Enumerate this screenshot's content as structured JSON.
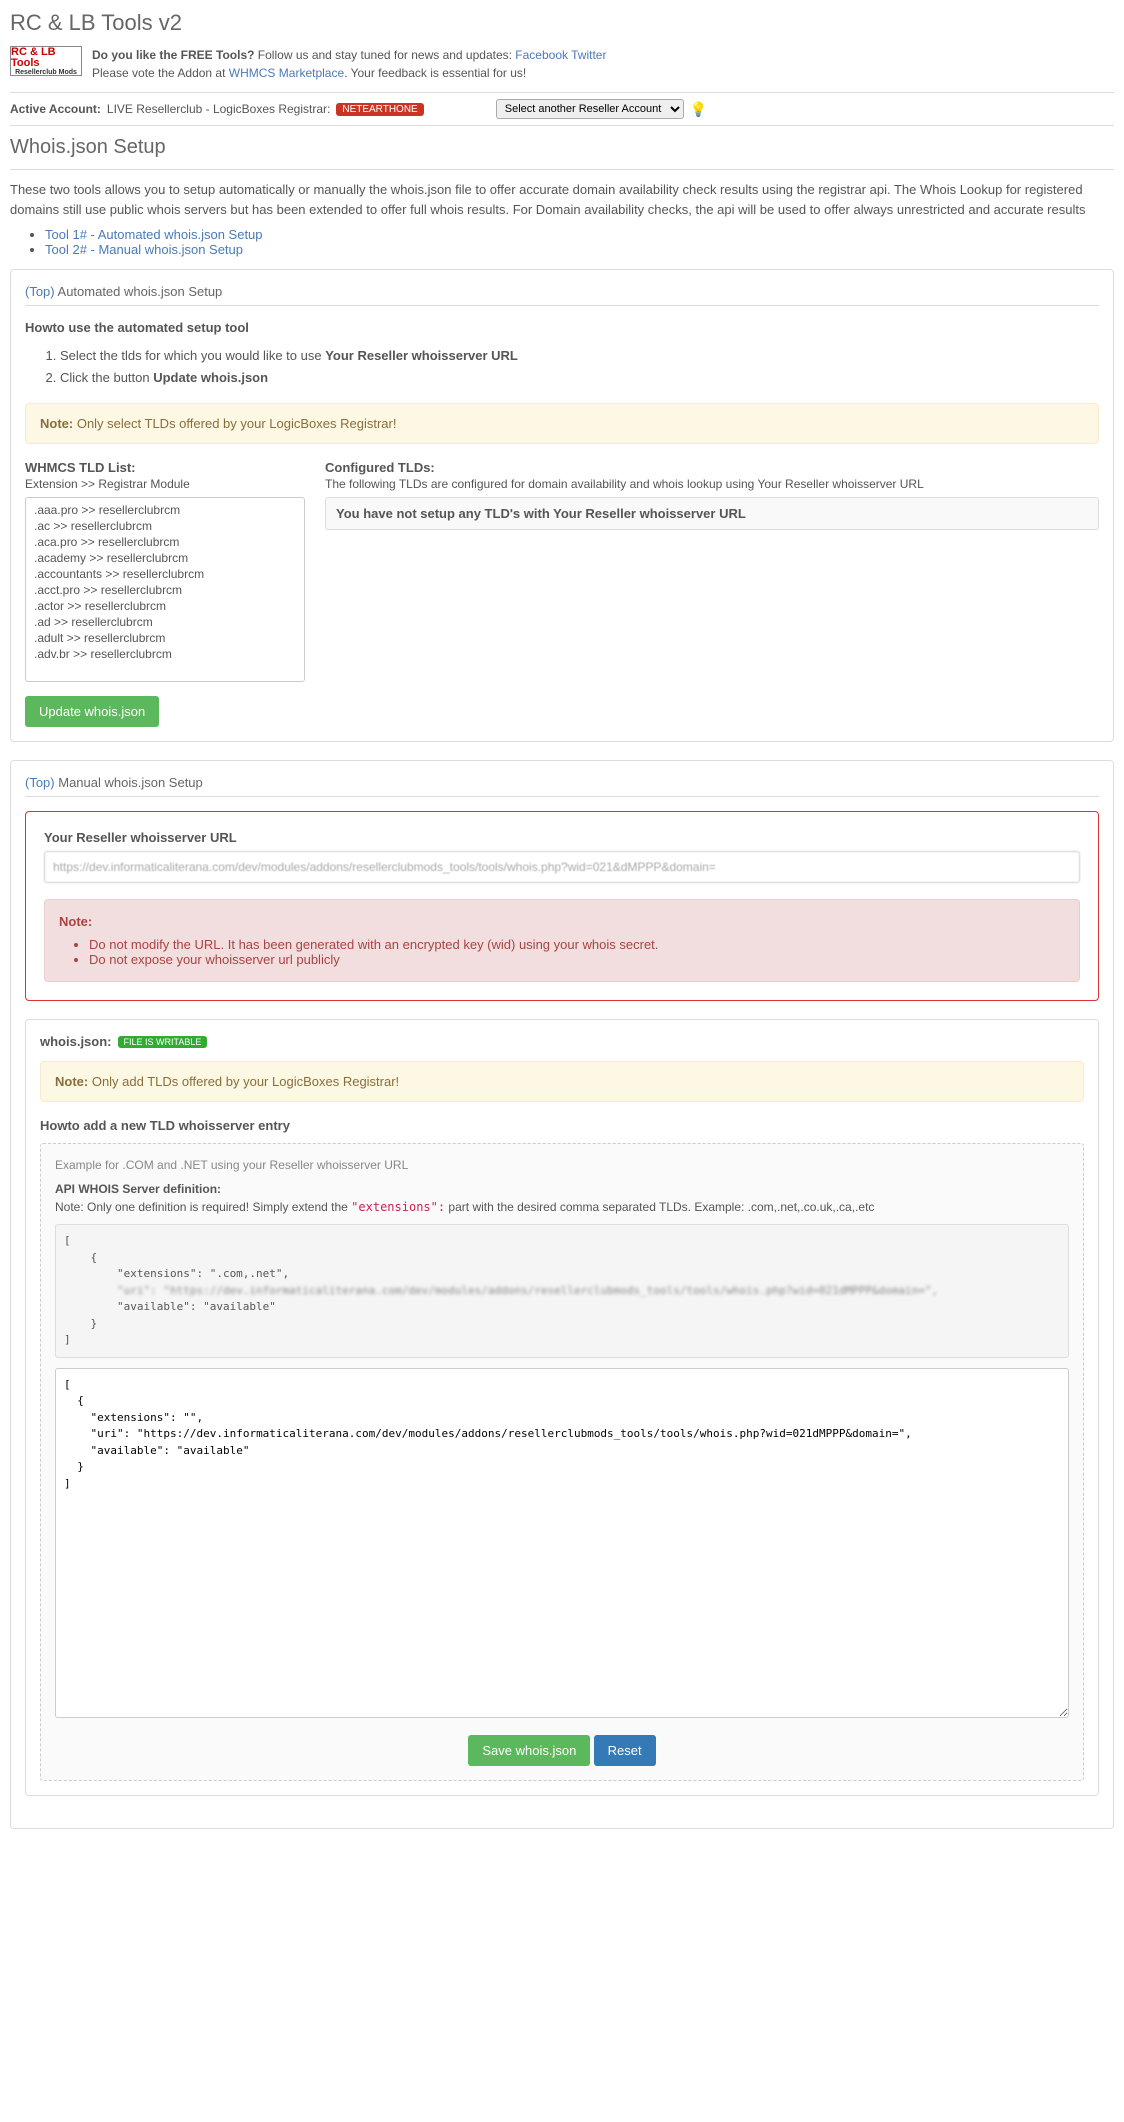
{
  "title": "RC & LB Tools v2",
  "logo": {
    "line1": "RC & LB Tools",
    "line2": "Resellerclub Mods"
  },
  "header_line1_a": "Do you like the FREE Tools?",
  "header_line1_b": " Follow us and stay tuned for news and updates: ",
  "link_fb": "Facebook",
  "link_tw": "Twitter",
  "header_line2_a": "Please vote the Addon at ",
  "link_mp": "WHMCS Marketplace",
  "header_line2_b": ". Your feedback is essential for us!",
  "account": {
    "label": "Active Account:",
    "value": "LIVE Resellerclub - LogicBoxes Registrar:",
    "badge": "NETEARTHONE",
    "select": "Select another Reseller Account"
  },
  "page_heading": "Whois.json Setup",
  "intro": "These two tools allows you to setup automatically or manually the whois.json file to offer accurate domain availability check results using the registrar api. The Whois Lookup for registered domains still use public whois servers but has been extended to offer full whois results. For Domain availability checks, the api will be used to offer always unrestricted and accurate results",
  "tool_links": [
    "Tool 1# - Automated whois.json Setup",
    "Tool 2# - Manual whois.json Setup"
  ],
  "auto": {
    "top": "(Top)",
    "title": " Automated whois.json Setup",
    "howto": "Howto use the automated setup tool",
    "step1a": "Select the tlds for which you would like to use ",
    "step1b": "Your Reseller whoisserver URL",
    "step2a": "Click the button ",
    "step2b": "Update whois.json",
    "note_label": "Note:",
    "note_text": " Only select TLDs offered by your LogicBoxes Registrar!",
    "list_title": "WHMCS TLD List:",
    "list_sub": "Extension >> Registrar Module",
    "tlds": [
      ".aaa.pro >> resellerclubrcm",
      ".ac >> resellerclubrcm",
      ".aca.pro >> resellerclubrcm",
      ".academy >> resellerclubrcm",
      ".accountants >> resellerclubrcm",
      ".acct.pro >> resellerclubrcm",
      ".actor >> resellerclubrcm",
      ".ad >> resellerclubrcm",
      ".adult >> resellerclubrcm",
      ".adv.br >> resellerclubrcm"
    ],
    "conf_title": "Configured TLDs:",
    "conf_sub": "The following TLDs are configured for domain availability and whois lookup using Your Reseller whoisserver URL",
    "conf_msg": "You have not setup any TLD's with Your Reseller whoisserver URL",
    "btn": "Update whois.json"
  },
  "manual": {
    "top": "(Top)",
    "title": " Manual whois.json Setup",
    "url_label": "Your Reseller whoisserver URL",
    "url_value": "https://dev.informaticaliterana.com/dev/modules/addons/resellerclubmods_tools/tools/whois.php?wid=021&dMPPP&domain=",
    "note_label": "Note:",
    "note_items": [
      "Do not modify the URL. It has been generated with an encrypted key (wid) using your whois secret.",
      "Do not expose your whoisserver url publicly"
    ],
    "file_label": "whois.json:",
    "file_badge": "FILE IS WRITABLE",
    "note2_label": "Note:",
    "note2_text": " Only add TLDs offered by your LogicBoxes Registrar!",
    "add_title": "Howto add a new TLD whoisserver entry",
    "ex_title": "Example for .COM and .NET using your Reseller whoisserver URL",
    "api_def": "API WHOIS Server definition:",
    "api_note_a": "Note: Only one definition is required! Simply extend the ",
    "api_note_code": "\"extensions\":",
    "api_note_b": " part with the desired comma separated TLDs. Example: .com,.net,.co.uk,.ca,.etc",
    "code_example": "[\n    {\n        \"extensions\": \".com,.net\",\n        \"uri\": \"https://dev.informaticaliterana.com/dev/modules/addons/resellerclubmods_tools/tools/whois.php?wid=021dMPPP&domain=\",\n        \"available\": \"available\"\n    }\n]",
    "textarea_value": "[\n  {\n    \"extensions\": \"\",\n    \"uri\": \"https://dev.informaticaliterana.com/dev/modules/addons/resellerclubmods_tools/tools/whois.php?wid=021dMPPP&domain=\",\n    \"available\": \"available\"\n  }\n]",
    "btn_save": "Save whois.json",
    "btn_reset": "Reset"
  }
}
